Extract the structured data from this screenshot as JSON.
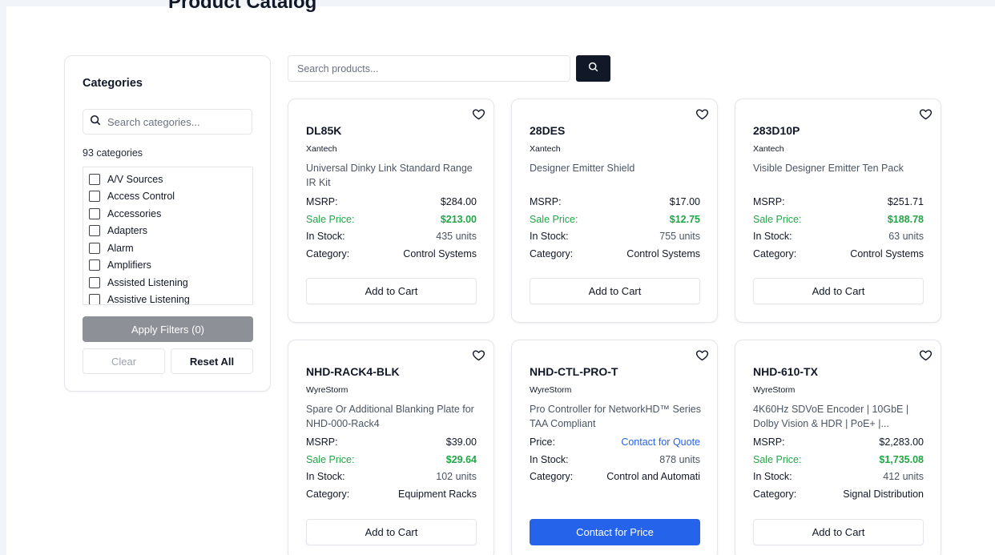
{
  "page": {
    "heading": "Product Catalog"
  },
  "sidebar": {
    "title": "Categories",
    "search_placeholder": "Search categories...",
    "count": "93 categories",
    "categories": [
      "A/V Sources",
      "Access Control",
      "Accessories",
      "Adapters",
      "Alarm",
      "Amplifiers",
      "Assisted Listening",
      "Assistive Listening"
    ],
    "apply_label": "Apply Filters (0)",
    "clear_label": "Clear",
    "reset_label": "Reset All"
  },
  "search": {
    "placeholder": "Search products...",
    "button_icon": "search-icon"
  },
  "products": [
    {
      "sku": "DL85K",
      "brand": "Xantech",
      "description": "Universal Dinky Link Standard Range IR Kit",
      "msrp_label": "MSRP:",
      "msrp": "$284.00",
      "sale_label": "Sale Price:",
      "sale": "$213.00",
      "stock_label": "In Stock:",
      "stock": "435 units",
      "category_label": "Category:",
      "category": "Control Systems",
      "button": "Add to Cart"
    },
    {
      "sku": "28DES",
      "brand": "Xantech",
      "description": "Designer Emitter Shield",
      "msrp_label": "MSRP:",
      "msrp": "$17.00",
      "sale_label": "Sale Price:",
      "sale": "$12.75",
      "stock_label": "In Stock:",
      "stock": "755 units",
      "category_label": "Category:",
      "category": "Control Systems",
      "button": "Add to Cart"
    },
    {
      "sku": "283D10P",
      "brand": "Xantech",
      "description": "Visible Designer Emitter Ten Pack",
      "msrp_label": "MSRP:",
      "msrp": "$251.71",
      "sale_label": "Sale Price:",
      "sale": "$188.78",
      "stock_label": "In Stock:",
      "stock": "63 units",
      "category_label": "Category:",
      "category": "Control Systems",
      "button": "Add to Cart"
    },
    {
      "sku": "NHD-RACK4-BLK",
      "brand": "WyreStorm",
      "description": "Spare Or Additional Blanking Plate for NHD-000-Rack4",
      "msrp_label": "MSRP:",
      "msrp": "$39.00",
      "sale_label": "Sale Price:",
      "sale": "$29.64",
      "stock_label": "In Stock:",
      "stock": "102 units",
      "category_label": "Category:",
      "category": "Equipment Racks",
      "button": "Add to Cart"
    },
    {
      "sku": "NHD-CTL-PRO-T",
      "brand": "WyreStorm",
      "description": "Pro Controller for NetworkHD™ Series TAA Compliant",
      "price_label": "Price:",
      "price": "Contact for Quote",
      "stock_label": "In Stock:",
      "stock": "878 units",
      "category_label": "Category:",
      "category": "Control and Automati",
      "button": "Contact for Price"
    },
    {
      "sku": "NHD-610-TX",
      "brand": "WyreStorm",
      "description": "4K60Hz SDVoE Encoder | 10GbE | Dolby Vision & HDR | PoE+ |...",
      "msrp_label": "MSRP:",
      "msrp": "$2,283.00",
      "sale_label": "Sale Price:",
      "sale": "$1,735.08",
      "stock_label": "In Stock:",
      "stock": "412 units",
      "category_label": "Category:",
      "category": "Signal Distribution",
      "button": "Add to Cart"
    }
  ],
  "colors": {
    "sale_green": "#22a447",
    "quote_blue": "#2563eb",
    "primary_button": "#2563eb",
    "search_button": "#111827",
    "apply_button_disabled": "#8d9096"
  }
}
